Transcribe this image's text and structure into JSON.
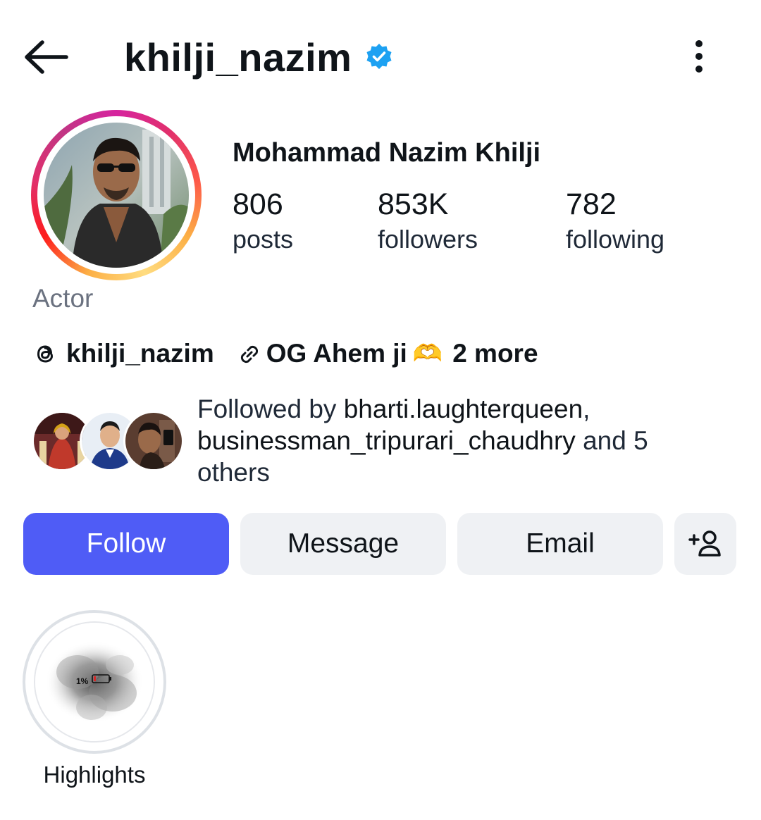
{
  "header": {
    "username": "khilji_nazim",
    "back_icon": "arrow-left-icon",
    "verified_icon": "verified-badge-icon",
    "more_icon": "more-vertical-icon"
  },
  "profile": {
    "full_name": "Mohammad Nazim Khilji",
    "category": "Actor",
    "avatar": "profile-photo"
  },
  "stats": [
    {
      "value": "806",
      "label": "posts"
    },
    {
      "value": "853K",
      "label": "followers"
    },
    {
      "value": "782",
      "label": "following"
    }
  ],
  "links": {
    "threads_handle": "khilji_nazim",
    "threads_icon": "threads-icon",
    "link_text": "OG Ahem ji",
    "link_icon": "chain-link-icon",
    "emoji": "🫶",
    "more": "2 more"
  },
  "followed_by": {
    "prefix": "Followed by ",
    "user1": "bharti.laughterqueen",
    "separator": ",",
    "user2": "businessman_tripurari_chaudhry",
    "suffix": " and 5 others"
  },
  "buttons": {
    "follow": "Follow",
    "message": "Message",
    "email": "Email",
    "add_user_icon": "add-person-icon"
  },
  "highlights": [
    {
      "label": "Highlights",
      "cover_text": "1%"
    }
  ],
  "colors": {
    "follow_button": "#4f5cf6",
    "secondary_button": "#eff1f4",
    "verified": "#1da1f2",
    "muted_text": "#6b7280"
  }
}
